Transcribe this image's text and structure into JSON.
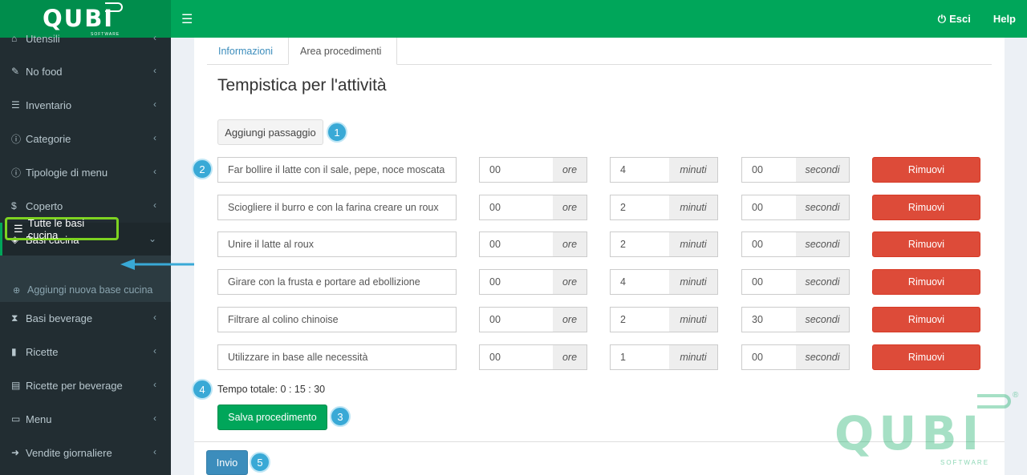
{
  "app": {
    "logo": "QUBI",
    "logo_sub": "SOFTWARE",
    "exit_label": "Esci",
    "help_label": "Help"
  },
  "sidebar": {
    "items": [
      {
        "label": "Utensili",
        "icon": "home-icon"
      },
      {
        "label": "No food",
        "icon": "wrench-icon"
      },
      {
        "label": "Inventario",
        "icon": "list-icon"
      },
      {
        "label": "Categorie",
        "icon": "info-icon"
      },
      {
        "label": "Tipologie di menu",
        "icon": "info-icon"
      },
      {
        "label": "Coperto",
        "icon": "dollar-icon"
      },
      {
        "label": "Basi cucina",
        "icon": "cube-icon"
      },
      {
        "label": "Basi beverage",
        "icon": "hourglass-icon"
      },
      {
        "label": "Ricette",
        "icon": "file-icon"
      },
      {
        "label": "Ricette per beverage",
        "icon": "file-text-icon"
      },
      {
        "label": "Menu",
        "icon": "card-icon"
      },
      {
        "label": "Vendite giornaliere",
        "icon": "arrow-circle-icon"
      }
    ],
    "submenu": [
      {
        "label": "Tutte le basi cucina",
        "icon": "list-icon"
      },
      {
        "label": "Aggiungi nuova base cucina",
        "icon": "plus-circle-icon"
      }
    ]
  },
  "tabs": [
    {
      "label": "Informazioni"
    },
    {
      "label": "Area procedimenti"
    }
  ],
  "page_title": "Tempistica per l'attività",
  "add_step_label": "Aggiungi passaggio",
  "units": {
    "hours": "ore",
    "minutes": "minuti",
    "seconds": "secondi"
  },
  "remove_label": "Rimuovi",
  "steps": [
    {
      "desc": "Far bollire il latte con il sale, pepe, noce moscata",
      "h": "00",
      "m": "4",
      "s": "00"
    },
    {
      "desc": "Sciogliere il burro e con la farina creare un roux",
      "h": "00",
      "m": "2",
      "s": "00"
    },
    {
      "desc": "Unire il latte al roux",
      "h": "00",
      "m": "2",
      "s": "00"
    },
    {
      "desc": "Girare con la frusta e portare ad ebollizione",
      "h": "00",
      "m": "4",
      "s": "00"
    },
    {
      "desc": "Filtrare al colino chinoise",
      "h": "00",
      "m": "2",
      "s": "30"
    },
    {
      "desc": "Utilizzare in base alle necessità",
      "h": "00",
      "m": "1",
      "s": "00"
    }
  ],
  "total_label": "Tempo totale: 0 : 15 : 30",
  "save_label": "Salva procedimento",
  "submit_label": "Invio",
  "badges": [
    "1",
    "2",
    "3",
    "4",
    "5"
  ],
  "watermark": {
    "text": "QUBI",
    "sub": "SOFTWARE",
    "reg": "®"
  },
  "colors": {
    "green": "#00a65a",
    "red": "#dd4b39",
    "blue": "#3c8dbc",
    "sidebar": "#222d32",
    "badge": "#39a9d6",
    "highlight": "#7ed321"
  }
}
